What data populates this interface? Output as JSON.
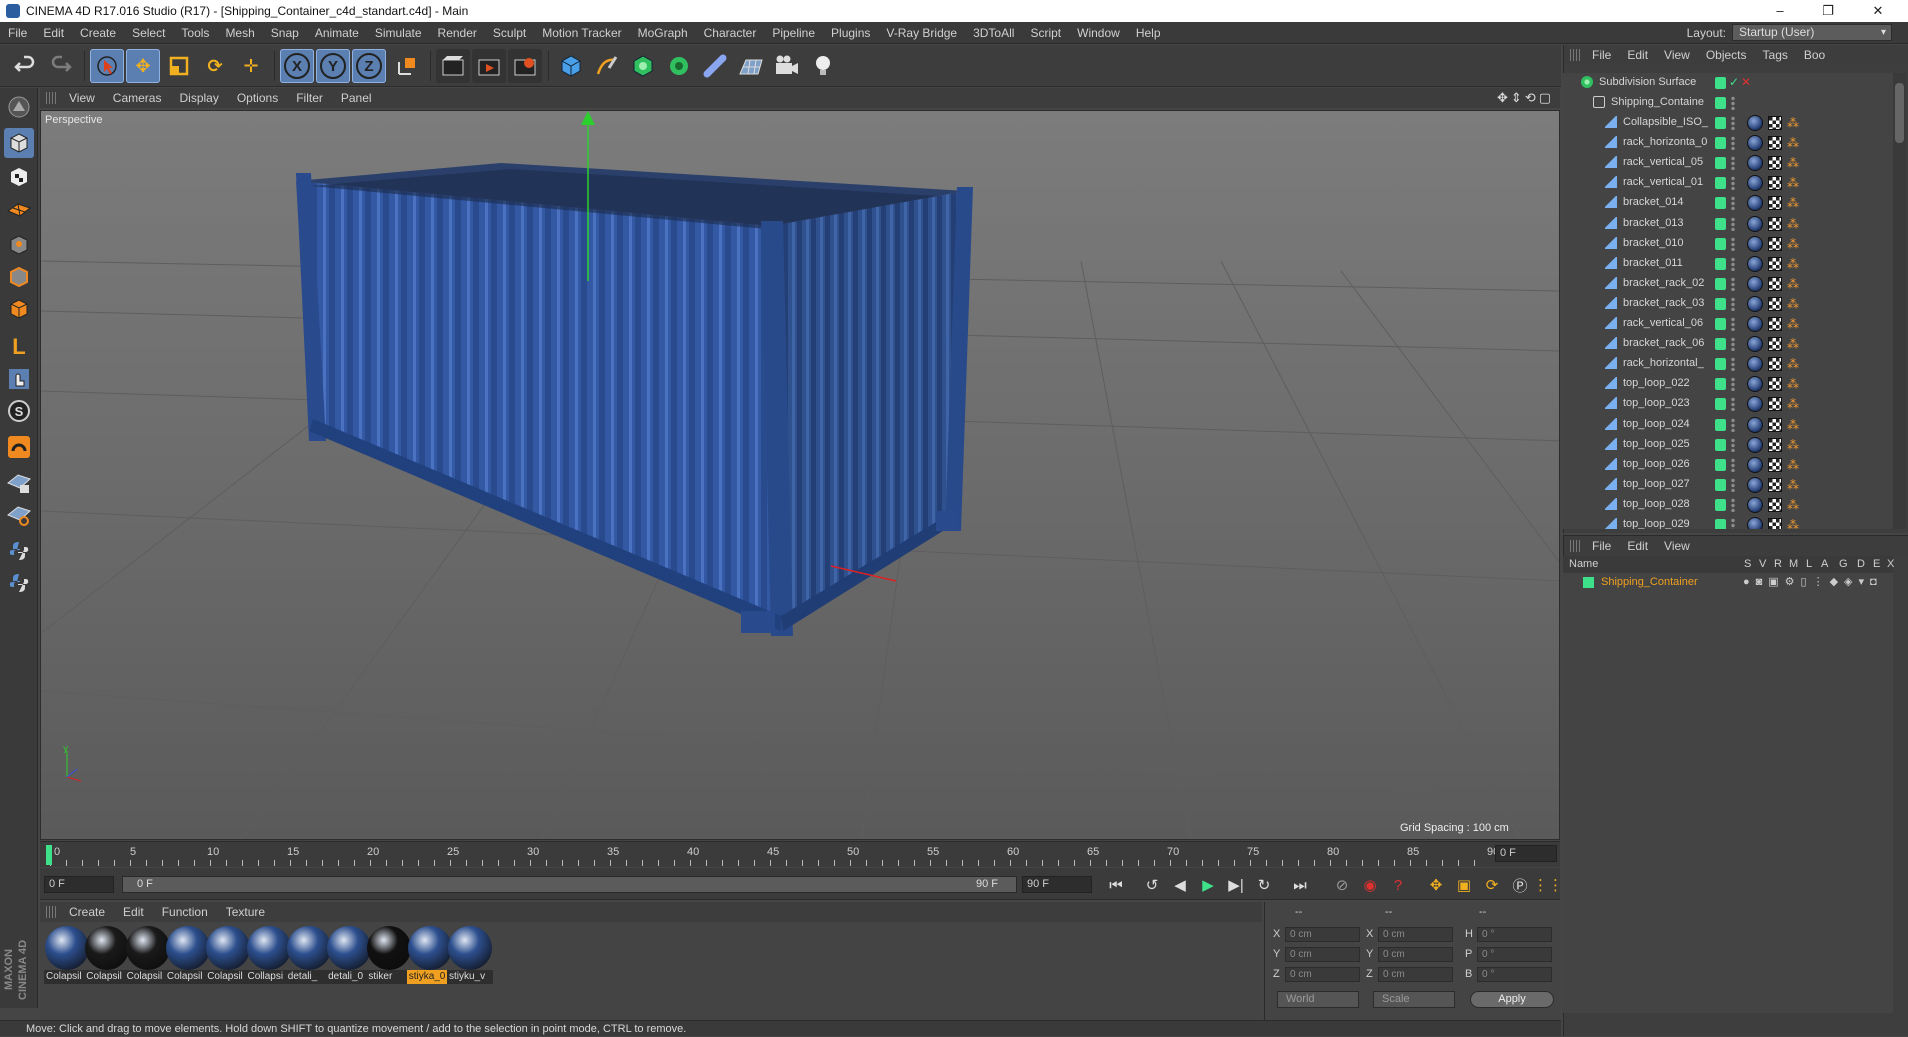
{
  "window": {
    "title": "CINEMA 4D R17.016 Studio (R17) - [Shipping_Container_c4d_standart.c4d] - Main",
    "minimize": "–",
    "restore": "❐",
    "close": "✕"
  },
  "menu": [
    "File",
    "Edit",
    "Create",
    "Select",
    "Tools",
    "Mesh",
    "Snap",
    "Animate",
    "Simulate",
    "Render",
    "Sculpt",
    "Motion Tracker",
    "MoGraph",
    "Character",
    "Pipeline",
    "Plugins",
    "V-Ray Bridge",
    "3DToAll",
    "Script",
    "Window",
    "Help"
  ],
  "layout": {
    "label": "Layout:",
    "value": "Startup (User)"
  },
  "viewport": {
    "menu": [
      "View",
      "Cameras",
      "Display",
      "Options",
      "Filter",
      "Panel"
    ],
    "label": "Perspective",
    "grid_spacing": "Grid Spacing : 100 cm"
  },
  "timeline": {
    "ticks": [
      "0",
      "5",
      "10",
      "15",
      "20",
      "25",
      "30",
      "35",
      "40",
      "45",
      "50",
      "55",
      "60",
      "65",
      "70",
      "75",
      "80",
      "85",
      "90"
    ],
    "current_frame": "0 F",
    "start_field": "0 F",
    "range_start": "0 F",
    "range_end": "90 F",
    "end_field": "90 F"
  },
  "materials": {
    "menu": [
      "Create",
      "Edit",
      "Function",
      "Texture"
    ],
    "items": [
      {
        "label": "Colapsil",
        "color": "#2d4f8e",
        "selected": false
      },
      {
        "label": "Colapsil",
        "color": "#1a1a1a",
        "selected": false
      },
      {
        "label": "Colapsil",
        "color": "#1a1a1a",
        "selected": false
      },
      {
        "label": "Colapsil",
        "color": "#2d4f8e",
        "selected": false
      },
      {
        "label": "Colapsil",
        "color": "#2d4f8e",
        "selected": false
      },
      {
        "label": "Collapsi",
        "color": "#2d4f8e",
        "selected": false
      },
      {
        "label": "detali_",
        "color": "#2d4f8e",
        "selected": false
      },
      {
        "label": "detali_0",
        "color": "#2d4f8e",
        "selected": false
      },
      {
        "label": "stiker",
        "color": "#111111",
        "selected": false
      },
      {
        "label": "stiyka_0",
        "color": "#2d4f8e",
        "selected": true
      },
      {
        "label": "stiyku_v",
        "color": "#2d4f8e",
        "selected": false
      }
    ]
  },
  "coordinates": {
    "headers": [
      "--",
      "--",
      "--"
    ],
    "rows": [
      {
        "a": "X",
        "av": "0 cm",
        "b": "X",
        "bv": "0 cm",
        "c": "H",
        "cv": "0 °"
      },
      {
        "a": "Y",
        "av": "0 cm",
        "b": "Y",
        "bv": "0 cm",
        "c": "P",
        "cv": "0 °"
      },
      {
        "a": "Z",
        "av": "0 cm",
        "b": "Z",
        "bv": "0 cm",
        "c": "B",
        "cv": "0 °"
      }
    ],
    "space": "World",
    "mode": "Scale",
    "apply": "Apply"
  },
  "status": "Move: Click and drag to move elements. Hold down SHIFT to quantize movement / add to the selection in point mode, CTRL to remove.",
  "object_manager": {
    "menu": [
      "File",
      "Edit",
      "View",
      "Objects",
      "Tags",
      "Boo"
    ],
    "root": "Subdivision Surface",
    "group": "Shipping_Containe",
    "children": [
      "Collapsible_ISO_",
      "rack_horizonta_0",
      "rack_vertical_05",
      "rack_vertical_01",
      "bracket_014",
      "bracket_013",
      "bracket_010",
      "bracket_011",
      "bracket_rack_02",
      "bracket_rack_03",
      "rack_vertical_06",
      "bracket_rack_06",
      "rack_horizontal_",
      "top_loop_022",
      "top_loop_023",
      "top_loop_024",
      "top_loop_025",
      "top_loop_026",
      "top_loop_027",
      "top_loop_028",
      "top_loop_029"
    ]
  },
  "layer_manager": {
    "menu": [
      "File",
      "Edit",
      "View"
    ],
    "columns": [
      "Name",
      "S",
      "V",
      "R",
      "M",
      "L",
      "A",
      "G",
      "D",
      "E",
      "X"
    ],
    "rows": [
      "Shipping_Container"
    ]
  },
  "colors": {
    "accent_blue": "#5a7fb0",
    "layer_orange": "#f0a020",
    "visible_green": "#3ee08a",
    "container_blue": "#2f56a0"
  }
}
